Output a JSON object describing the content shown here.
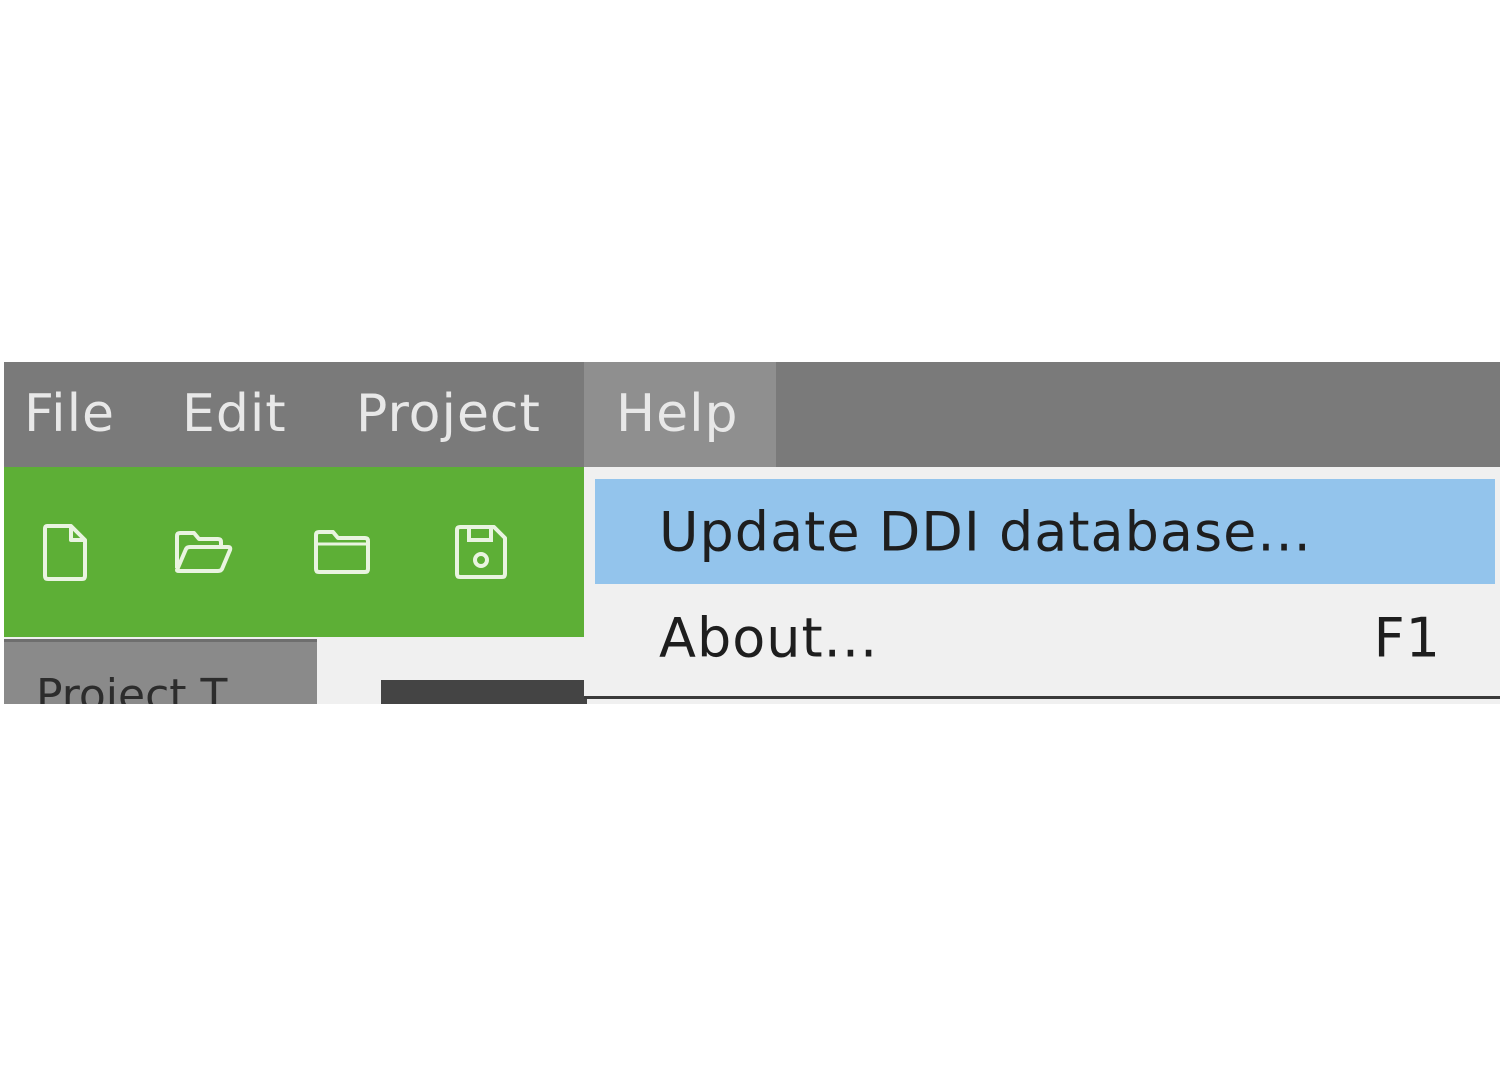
{
  "menubar": {
    "items": [
      {
        "label": "File"
      },
      {
        "label": "Edit"
      },
      {
        "label": "Project"
      },
      {
        "label": "Help"
      }
    ],
    "active": "Help"
  },
  "toolbar": {
    "buttons": [
      {
        "icon": "new-file-icon"
      },
      {
        "icon": "open-folder-icon"
      },
      {
        "icon": "folder-icon"
      },
      {
        "icon": "save-icon"
      }
    ]
  },
  "project_tab": {
    "label": "Project T"
  },
  "help_menu": {
    "items": [
      {
        "label": "Update DDI database...",
        "shortcut": "",
        "highlighted": true
      },
      {
        "label": "About...",
        "shortcut": "F1",
        "highlighted": false
      }
    ]
  },
  "colors": {
    "menubar_bg": "#7a7a7a",
    "menubar_active_bg": "#8f8f8f",
    "toolbar_bg": "#5daf36",
    "menu_highlight": "#93c4ec",
    "menu_bg": "#f0f0f0"
  }
}
